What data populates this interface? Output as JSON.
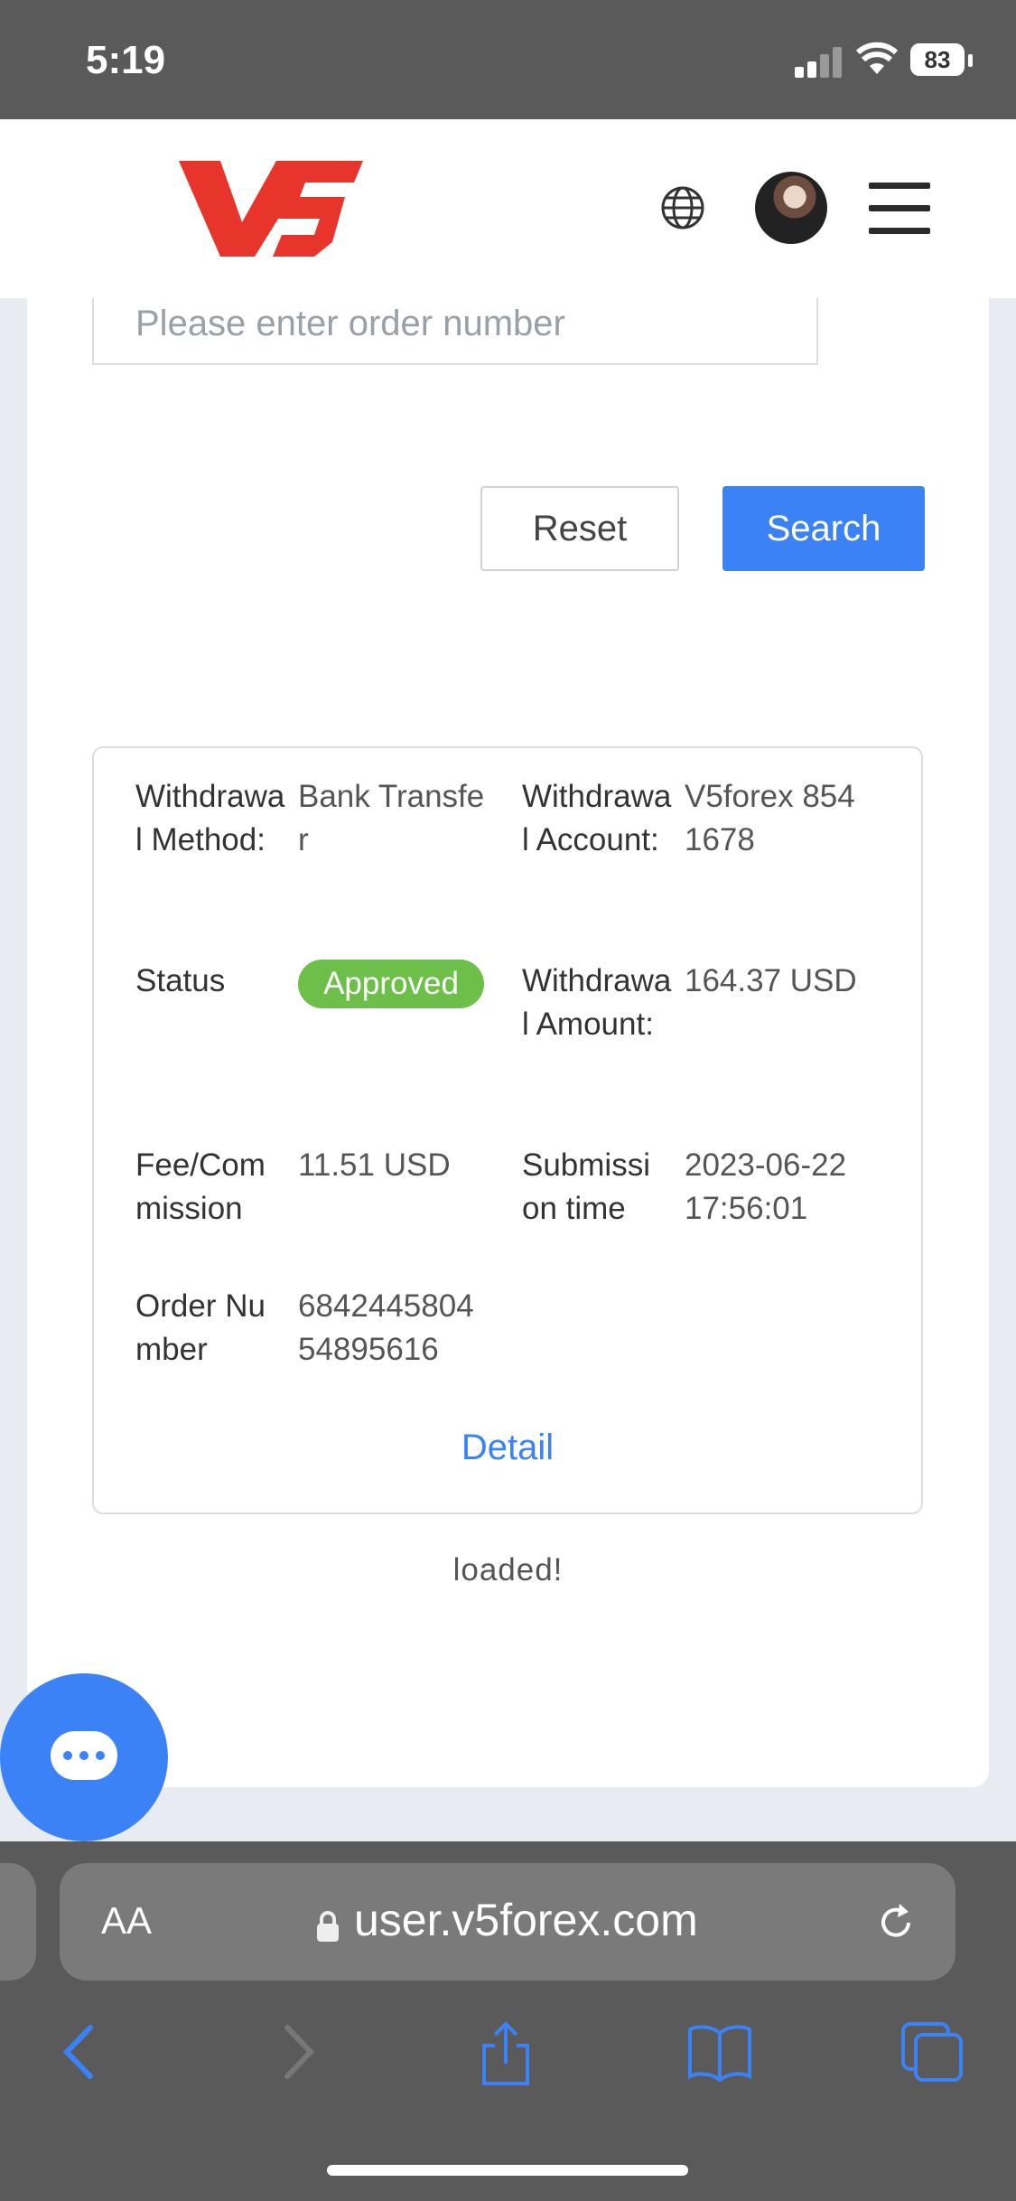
{
  "status_bar": {
    "time": "5:19",
    "battery": "83"
  },
  "header": {
    "logo_text": "V5"
  },
  "search": {
    "order_placeholder": "Please enter order number",
    "reset_label": "Reset",
    "search_label": "Search"
  },
  "record": {
    "method_label": "Withdrawal Method:",
    "method_value": "Bank Transfer",
    "account_label": "Withdrawal Account:",
    "account_value": "V5forex 8541678",
    "status_label": "Status",
    "status_value": "Approved",
    "amount_label": "Withdrawal Amount:",
    "amount_value": "164.37 USD",
    "fee_label": "Fee/Commission",
    "fee_value": "11.51 USD",
    "time_label": "Submission time",
    "time_value": "2023-06-22 17:56:01",
    "order_label": "Order Number",
    "order_value": "684244580454895616",
    "detail_label": "Detail"
  },
  "loaded_text": "loaded!",
  "browser": {
    "aa_label": "AA",
    "url": "user.v5forex.com"
  },
  "colors": {
    "accent": "#3b82f6",
    "approved": "#6cc04a",
    "brand_red": "#e8352b"
  }
}
